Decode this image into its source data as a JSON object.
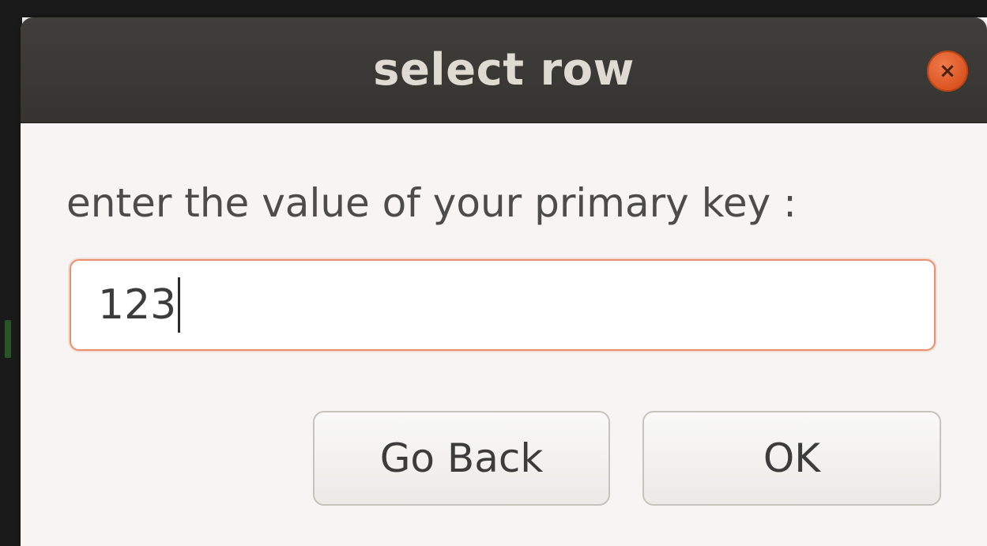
{
  "window": {
    "title": "select row",
    "close_icon": "×"
  },
  "form": {
    "prompt": "enter the value of your primary key :",
    "entry_value": "123"
  },
  "buttons": {
    "back_label": "Go Back",
    "ok_label": "OK"
  },
  "colors": {
    "titlebar": "#3c3b37",
    "close_button": "#e05a2a",
    "entry_focus_border": "#e8906e"
  }
}
